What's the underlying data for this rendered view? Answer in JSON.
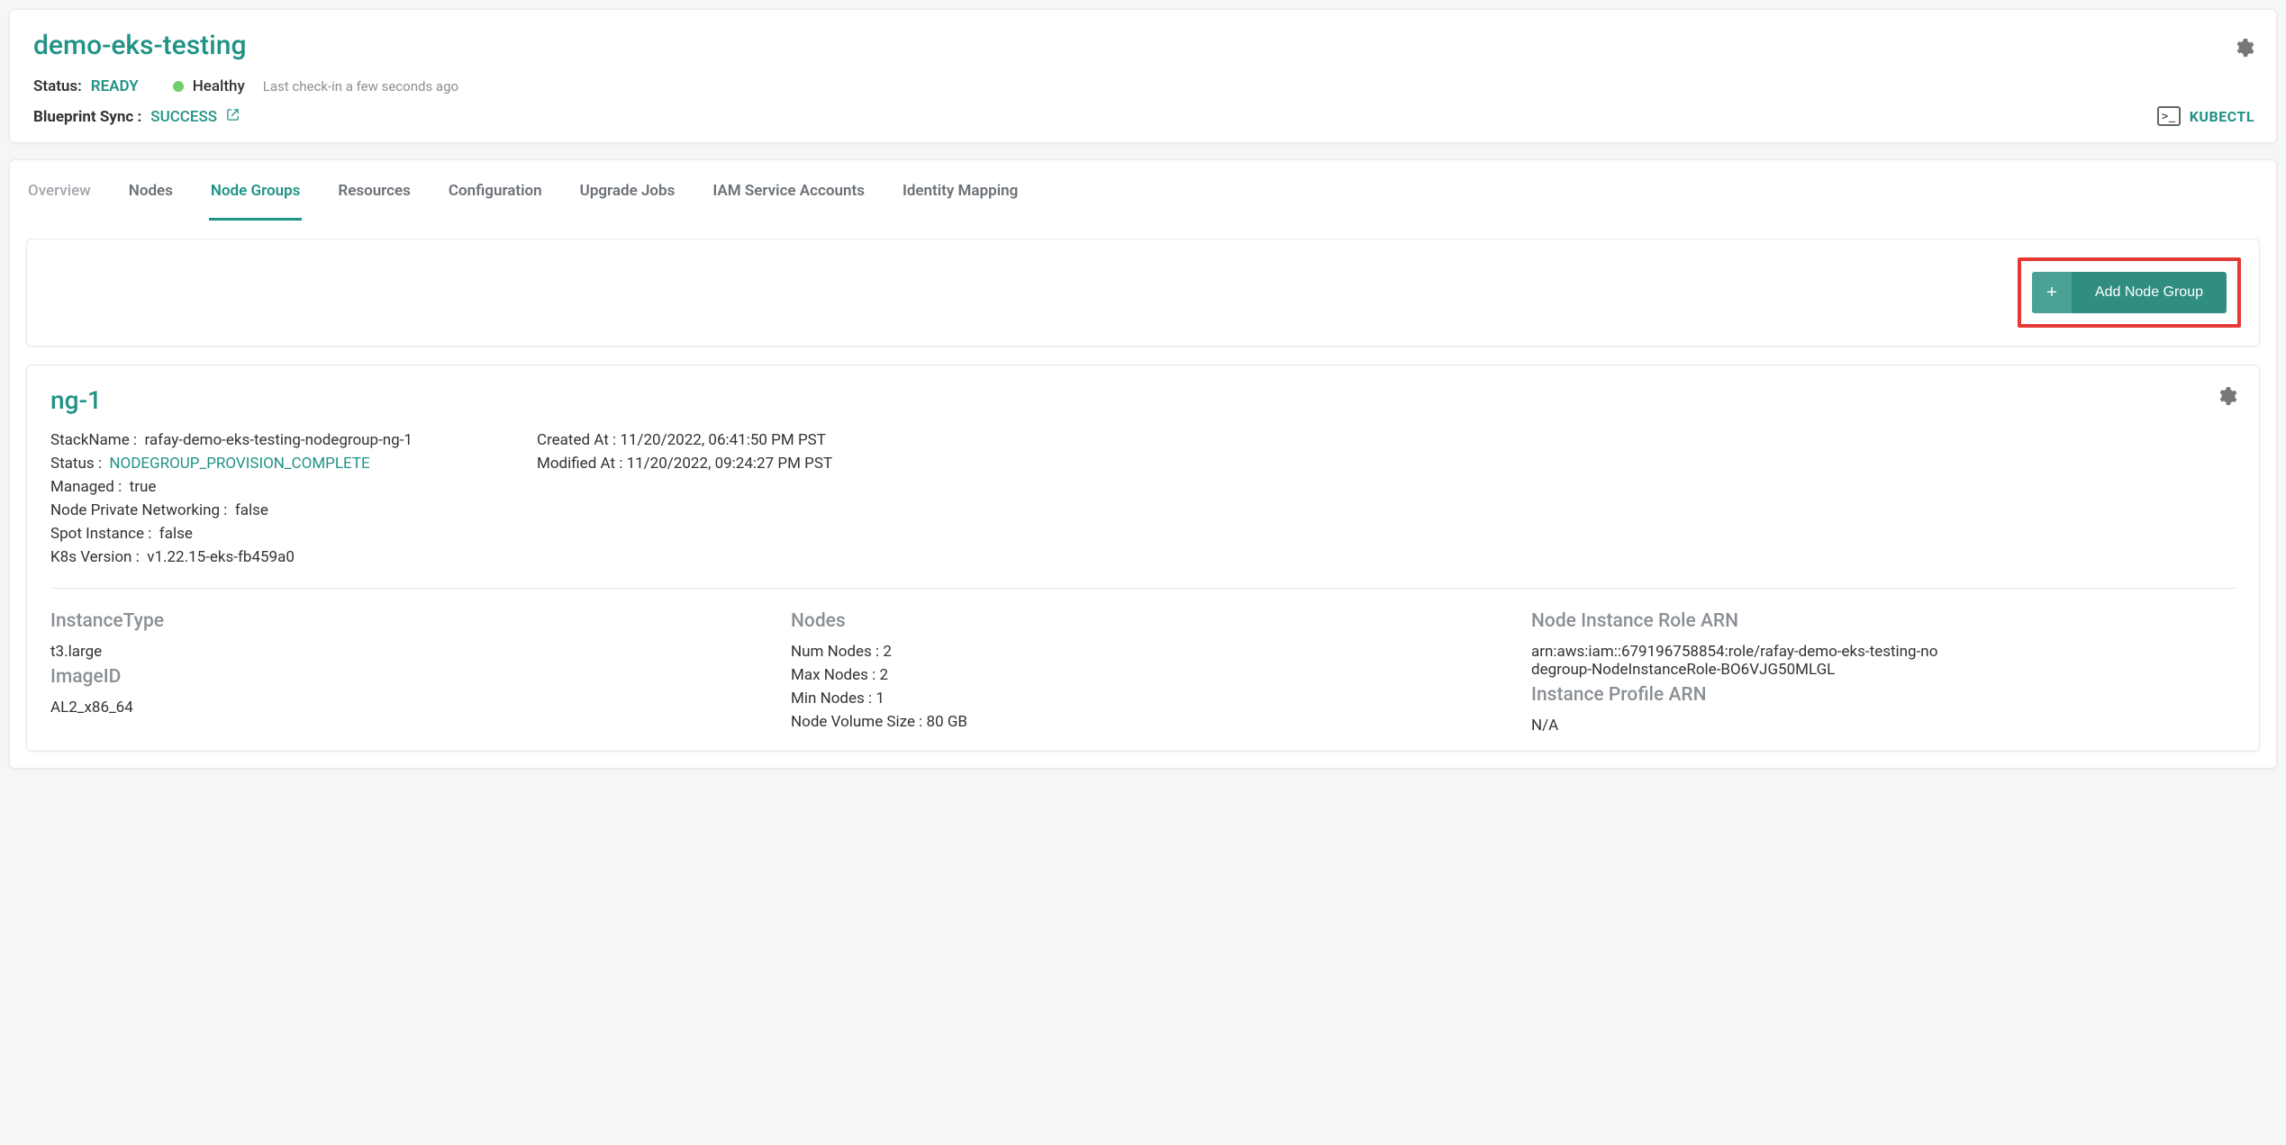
{
  "header": {
    "title": "demo-eks-testing",
    "status_label": "Status:",
    "status_value": "READY",
    "health_text": "Healthy",
    "checkin_text": "Last check-in a few seconds ago",
    "sync_label": "Blueprint Sync :",
    "sync_value": "SUCCESS",
    "kubectl_label": "KUBECTL"
  },
  "tabs": [
    {
      "label": "Overview",
      "active": false,
      "light": true
    },
    {
      "label": "Nodes",
      "active": false,
      "light": false
    },
    {
      "label": "Node Groups",
      "active": true,
      "light": false
    },
    {
      "label": "Resources",
      "active": false,
      "light": false
    },
    {
      "label": "Configuration",
      "active": false,
      "light": false
    },
    {
      "label": "Upgrade Jobs",
      "active": false,
      "light": false
    },
    {
      "label": "IAM Service Accounts",
      "active": false,
      "light": false
    },
    {
      "label": "Identity Mapping",
      "active": false,
      "light": false
    }
  ],
  "actions": {
    "add_node_group_label": "Add Node Group"
  },
  "node_group": {
    "name": "ng-1",
    "stack_name_label": "StackName :",
    "stack_name_value": "rafay-demo-eks-testing-nodegroup-ng-1",
    "status_label": "Status :",
    "status_value": "NODEGROUP_PROVISION_COMPLETE",
    "managed_label": "Managed :",
    "managed_value": "true",
    "private_net_label": "Node Private Networking :",
    "private_net_value": "false",
    "spot_label": "Spot Instance :",
    "spot_value": "false",
    "k8s_label": "K8s Version :",
    "k8s_value": "v1.22.15-eks-fb459a0",
    "created_label": "Created At :",
    "created_value": "11/20/2022, 06:41:50 PM PST",
    "modified_label": "Modified At :",
    "modified_value": "11/20/2022, 09:24:27 PM PST",
    "instance_type_title": "InstanceType",
    "instance_type_value": "t3.large",
    "image_id_title": "ImageID",
    "image_id_value": "AL2_x86_64",
    "nodes_title": "Nodes",
    "num_nodes_label": "Num Nodes :",
    "num_nodes_value": "2",
    "max_nodes_label": "Max Nodes :",
    "max_nodes_value": "2",
    "min_nodes_label": "Min Nodes :",
    "min_nodes_value": "1",
    "vol_label": "Node Volume Size :",
    "vol_value": "80 GB",
    "role_arn_title": "Node Instance Role ARN",
    "role_arn_value": "arn:aws:iam::679196758854:role/rafay-demo-eks-testing-nodegroup-NodeInstanceRole-BO6VJG50MLGL",
    "profile_arn_title": "Instance Profile ARN",
    "profile_arn_value": "N/A"
  }
}
